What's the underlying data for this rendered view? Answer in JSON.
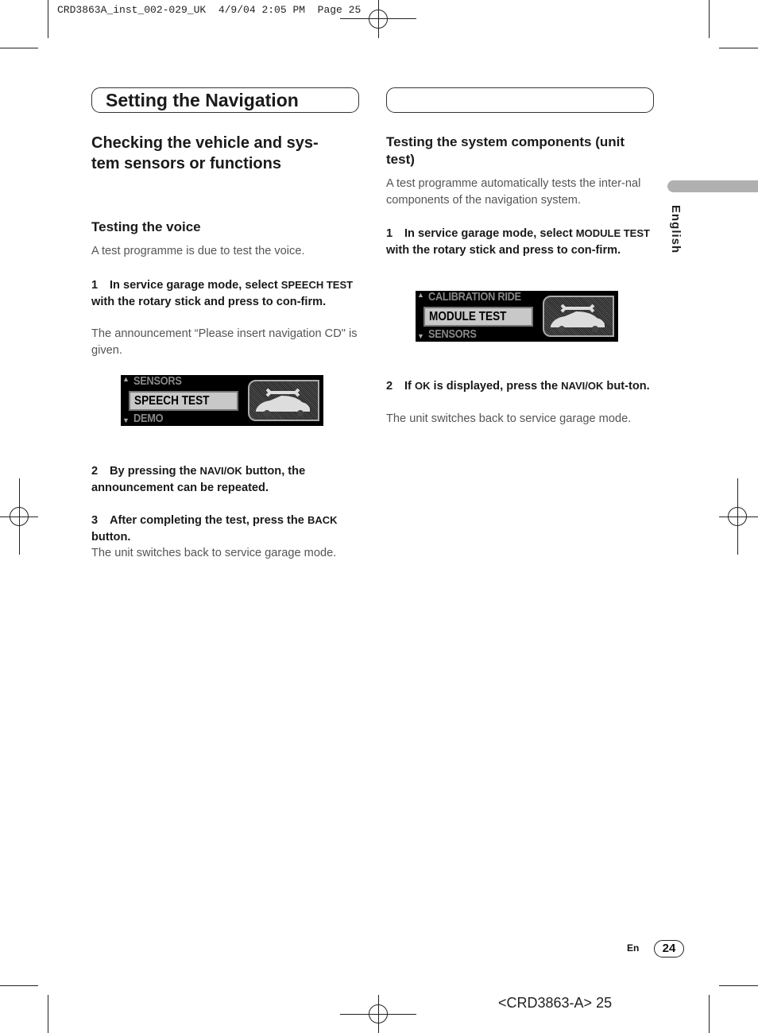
{
  "slug": "CRD3863A_inst_002-029_UK  4/9/04 2:05 PM  Page 25",
  "header": {
    "title": "Setting the Navigation"
  },
  "left": {
    "heading": "Checking the vehicle and sys-\ntem sensors or functions",
    "section_title": "Testing the voice",
    "intro": "A test programme is due to test the voice.",
    "step1": {
      "num": "1",
      "a": "In service garage mode, select ",
      "sc": "SPEECH TEST",
      "b": " with the rotary stick and press to con-firm."
    },
    "step1_note": "The announcement “Please insert navigation CD\" is given.",
    "screen": {
      "above": "SENSORS",
      "selected": "SPEECH TEST",
      "below": "DEMO"
    },
    "step2": {
      "num": "2",
      "a": "By pressing the ",
      "sc": "NAVI/OK",
      "b": " button, the announcement can be repeated."
    },
    "step3": {
      "num": "3",
      "a": "After completing the test, press the ",
      "sc": "BACK",
      "b": " button."
    },
    "step3_note": "The unit switches back to service garage mode."
  },
  "right": {
    "section_title": "Testing the system components (unit test)",
    "intro": "A test programme automatically tests the inter-nal components of the navigation system.",
    "step1": {
      "num": "1",
      "a": "In service garage mode, select ",
      "sc": "MODULE TEST",
      "b": " with the rotary stick and press to con-firm."
    },
    "screen": {
      "above": "CALIBRATION RIDE",
      "selected": "MODULE TEST",
      "below": "SENSORS"
    },
    "step2": {
      "num": "2",
      "a": "If ",
      "sc": "OK",
      "b": " is displayed, press the ",
      "sc2": "NAVI/OK",
      "c": " but-ton."
    },
    "step2_note": "The unit switches back to service garage mode."
  },
  "side_tab": "English",
  "footer": {
    "lang": "En",
    "page": "24",
    "code": "<CRD3863-A> 25"
  }
}
